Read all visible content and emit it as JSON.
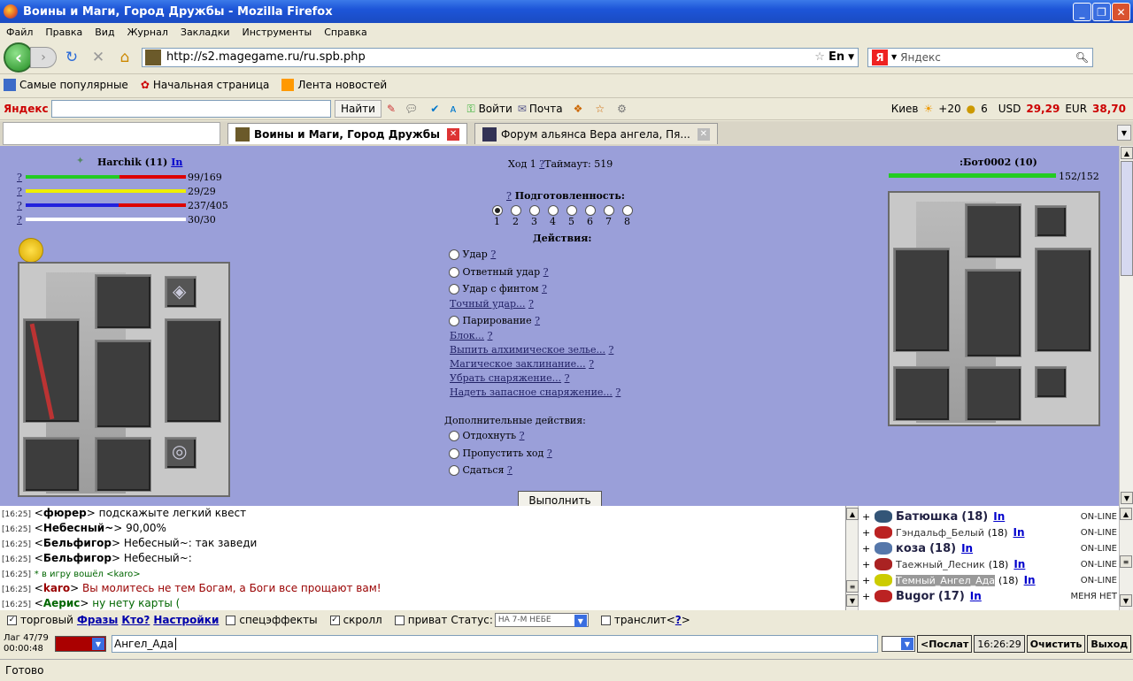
{
  "window": {
    "title": "Воины и Маги, Город Дружбы - Mozilla Firefox"
  },
  "menu": [
    "Файл",
    "Правка",
    "Вид",
    "Журнал",
    "Закладки",
    "Инструменты",
    "Справка"
  ],
  "nav": {
    "url": "http://s2.magegame.ru/ru.spb.php",
    "lang": "En",
    "search_placeholder": "Яндекс"
  },
  "bookmarks": [
    "Самые популярные",
    "Начальная страница",
    "Лента новостей"
  ],
  "yandex_bar": {
    "logo": "Яндекс",
    "find": "Найти",
    "login": "Войти",
    "mail": "Почта",
    "city": "Киев",
    "temp": "+20",
    "points": "6",
    "usd_label": "USD",
    "usd": "29,29",
    "eur_label": "EUR",
    "eur": "38,70"
  },
  "tabs": [
    {
      "label": "Воины и Маги, Город Дружбы"
    },
    {
      "label": "Форум альянса Вера ангела, Пя..."
    }
  ],
  "player": {
    "name": "Harchik (11)",
    "status": "In",
    "stats": [
      "99/169",
      "29/29",
      "237/405",
      "30/30"
    ],
    "hp_fraction": 0.586
  },
  "enemy": {
    "name": ":Бот0002 (10)",
    "hp": "152/152",
    "hp_fraction": 1.0
  },
  "turn": {
    "label": "Ход 1",
    "timeout": "Таймаут: 519"
  },
  "prep": {
    "title": "Подготовленность:",
    "levels": [
      "1",
      "2",
      "3",
      "4",
      "5",
      "6",
      "7",
      "8"
    ],
    "selected": "1"
  },
  "actions_title": "Действия:",
  "actions": [
    "Удар",
    "Ответный удар",
    "Удар с финтом"
  ],
  "links1": [
    "Точный удар..."
  ],
  "parry": "Парирование",
  "links2": [
    "Блок...",
    "Выпить алхимическое зелье...",
    "Магическое заклинание...",
    "Убрать снаряжение...",
    "Надеть запасное снаряжение..."
  ],
  "extra_title": "Дополнительные действия:",
  "extra": [
    "Отдохнуть",
    "Пропустить ход",
    "Сдаться"
  ],
  "execute": "Выполнить",
  "chat": [
    {
      "time": "[16:25]",
      "nick": "фюрер",
      "msg": "подскажыте легкий квест",
      "color": "#000"
    },
    {
      "time": "[16:25]",
      "nick": "Небесный~",
      "msg": "90,00%",
      "color": "#000"
    },
    {
      "time": "[16:25]",
      "nick": "Бельфигор",
      "msg": "Небесный~: так заведи",
      "color": "#000"
    },
    {
      "time": "[16:25]",
      "nick": "Бельфигор",
      "msg": "Небесный~:",
      "color": "#000"
    },
    {
      "time": "[16:25]",
      "nick": "",
      "msg": "* в игру вошёл <karo>",
      "color": "#060"
    },
    {
      "time": "[16:25]",
      "nick": "karo",
      "msg": "Вы молитесь не тем Богам, а Боги все прощают вам!",
      "color": "#900"
    },
    {
      "time": "[16:25]",
      "nick": "Аерис",
      "msg": "ну нету карты (",
      "color": "#060"
    }
  ],
  "online": [
    {
      "name": "Батюшка",
      "lvl": "(18)",
      "st": "ON-LINE",
      "bold": true,
      "color": "#224"
    },
    {
      "name": "Гэндальф_Белый",
      "lvl": "(18)",
      "st": "ON-LINE",
      "bold": false,
      "color": "#333"
    },
    {
      "name": "коза",
      "lvl": "(18)",
      "st": "ON-LINE",
      "bold": true,
      "color": "#224"
    },
    {
      "name": "Таежный_Лесник",
      "lvl": "(18)",
      "st": "ON-LINE",
      "bold": false,
      "color": "#333"
    },
    {
      "name": "Темный_Ангел_Ада",
      "lvl": "(18)",
      "st": "ON-LINE",
      "bold": false,
      "color": "#fff"
    },
    {
      "name": "Bugor",
      "lvl": "(17)",
      "st": "МЕНЯ НЕТ",
      "bold": true,
      "color": "#224"
    }
  ],
  "options": {
    "trade": "торговый",
    "phrases": "Фразы",
    "who": "Кто?",
    "settings": "Настройки",
    "effects": "спецэффекты",
    "scroll": "скролл",
    "private": "приват",
    "status_label": "Статус:",
    "status_value": "НА 7-М НЕБЕ",
    "translit": "транслит<",
    "translit_q": "?",
    "translit_end": ">"
  },
  "input": {
    "lag": "Лаг 47/79",
    "time": "00:00:48",
    "nick": "Ангел_Ада",
    "send": "<Послат",
    "clock": "16:26:29",
    "clear": "Очистить",
    "exit": "Выход"
  },
  "statusbar": "Готово"
}
